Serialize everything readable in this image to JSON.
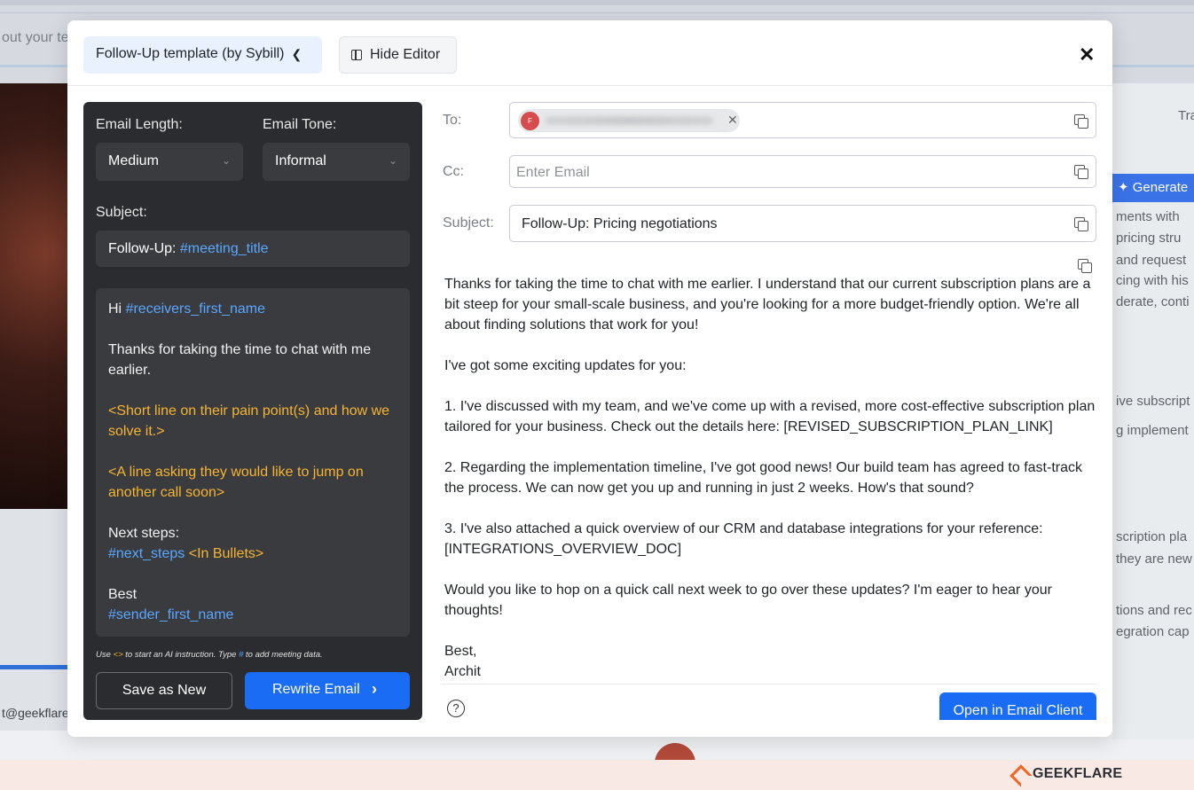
{
  "background": {
    "left_text": "out your te",
    "left_email": "t@geekflare",
    "right_top_label": "Tra",
    "generate_label": "✦ Generate",
    "right_lines": [
      "ments with",
      "pricing stru",
      "and request",
      "cing with his",
      "derate, conti",
      "ive subscript",
      "g implement",
      "scription pla",
      "they are new",
      "tions and rec",
      "egration cap"
    ],
    "brand": "GEEKFLARE"
  },
  "header": {
    "template_label": "Follow-Up template (by Sybill)",
    "hide_editor_label": "Hide Editor",
    "close_symbol": "✕"
  },
  "editor": {
    "length_label": "Email Length:",
    "length_value": "Medium",
    "tone_label": "Email Tone:",
    "tone_value": "Informal",
    "subject_label": "Subject:",
    "subject_prefix": "Follow-Up: ",
    "subject_var": "#meeting_title",
    "body": {
      "greeting": "Hi ",
      "greeting_var": "#receivers_first_name",
      "line1": "Thanks for taking the time to chat with me earlier.",
      "ai1": "<Short line on their pain point(s) and how we solve it.>",
      "ai2": "<A line asking they would like to jump on another call soon>",
      "next_steps_label": "Next steps:",
      "next_steps_var": "#next_steps",
      "next_steps_ai": " <In Bullets>",
      "signoff": "Best",
      "sender_var": "#sender_first_name"
    },
    "hint_use": "Use ",
    "hint_ai": "<>",
    "hint_mid": " to start an AI instruction. Type ",
    "hint_hash": "#",
    "hint_end": " to add meeting data.",
    "save_label": "Save as New",
    "rewrite_label": "Rewrite Email"
  },
  "email": {
    "to_label": "To:",
    "recipient_initial": "F",
    "cc_label": "Cc:",
    "cc_placeholder": "Enter Email",
    "subject_label": "Subject:",
    "subject_value": "Follow-Up: Pricing negotiations",
    "paragraphs": [
      "Thanks for taking the time to chat with me earlier. I understand that our current subscription plans are a bit steep for your small-scale business, and you're looking for a more budget-friendly option. We're all about finding solutions that work for you!",
      "I've got some exciting updates for you:",
      "1. I've discussed with my team, and we've come up with a revised, more cost-effective subscription plan tailored for your business. Check out the details here: [REVISED_SUBSCRIPTION_PLAN_LINK]",
      "2. Regarding the implementation timeline, I've got good news! Our build team has agreed to fast-track the process. We can now get you up and running in just 2 weeks. How's that sound?",
      "3. I've also attached a quick overview of our CRM and database integrations for your reference: [INTEGRATIONS_OVERVIEW_DOC]",
      "Would you like to hop on a quick call next week to go over these updates? I'm eager to hear your thoughts!"
    ],
    "signoff": "Best,",
    "signature": "Archit",
    "help_symbol": "?",
    "open_label": "Open in Email Client"
  },
  "icons": {
    "template_dropdown": "chevron-down-icon",
    "hide_editor": "panel-icon",
    "close": "close-icon",
    "copy": "copy-icon",
    "help": "help-icon",
    "rewrite_arrow": "chevron-right-icon"
  }
}
